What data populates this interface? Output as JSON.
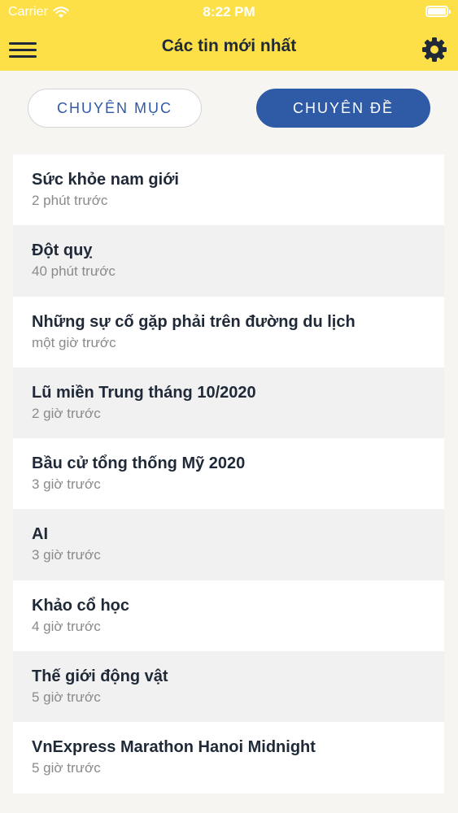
{
  "status_bar": {
    "carrier": "Carrier",
    "time": "8:22 PM"
  },
  "header": {
    "title": "Các tin mới nhất",
    "menu_icon": "hamburger-menu-icon",
    "settings_icon": "gear-icon",
    "background_color": "#fde047"
  },
  "tabs": [
    {
      "label": "CHUYÊN MỤC",
      "selected": false
    },
    {
      "label": "CHUYÊN ĐỀ",
      "selected": true
    }
  ],
  "accent_color": "#2f5aa6",
  "topics": [
    {
      "title": "Sức khỏe nam giới",
      "time": "2 phút trước"
    },
    {
      "title": "Đột quỵ",
      "time": "40 phút trước"
    },
    {
      "title": "Những sự cố gặp phải trên đường du lịch",
      "time": "một giờ trước"
    },
    {
      "title": "Lũ miền Trung tháng 10/2020",
      "time": "2 giờ trước"
    },
    {
      "title": "Bầu cử tổng thống Mỹ 2020",
      "time": "3 giờ trước"
    },
    {
      "title": "AI",
      "time": "3 giờ trước"
    },
    {
      "title": "Khảo cổ học",
      "time": "4 giờ trước"
    },
    {
      "title": "Thế giới động vật",
      "time": "5 giờ trước"
    },
    {
      "title": "VnExpress Marathon Hanoi Midnight",
      "time": "5 giờ trước"
    }
  ]
}
